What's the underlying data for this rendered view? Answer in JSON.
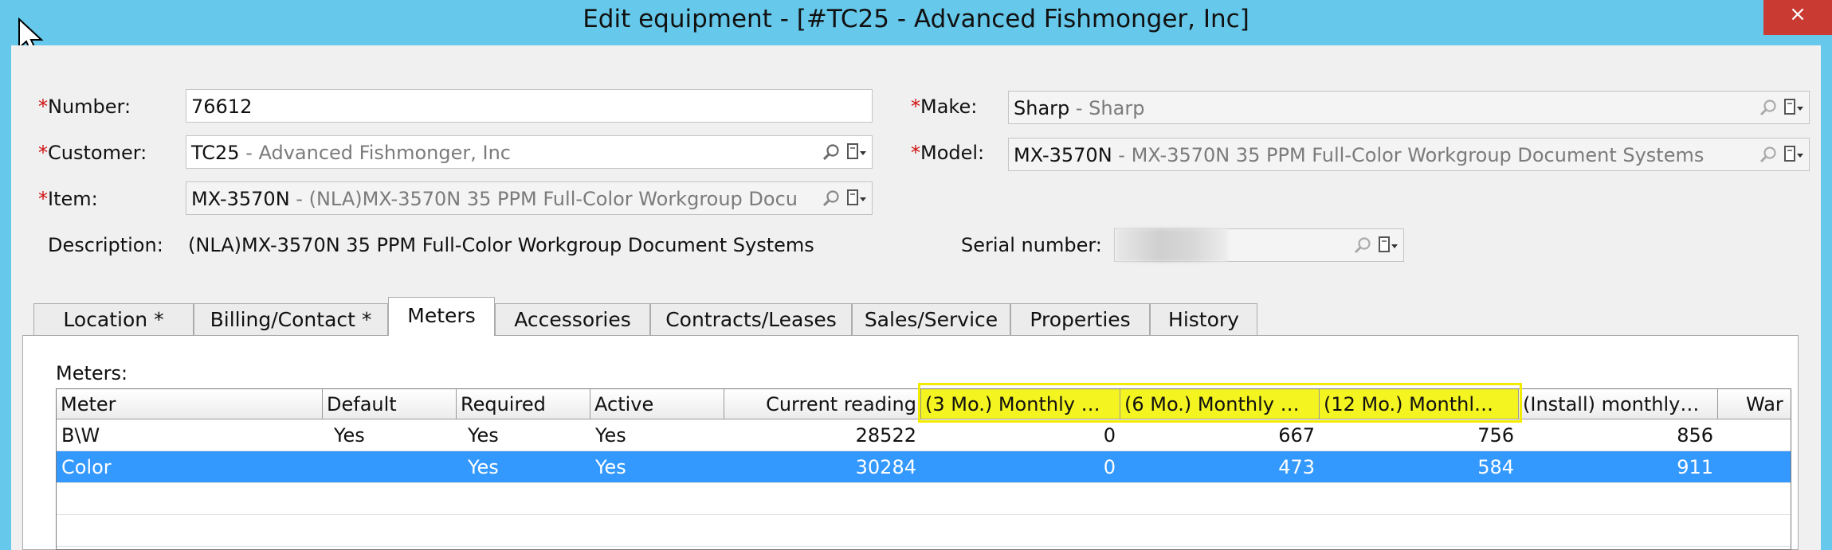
{
  "window": {
    "title": "Edit equipment - [#TC25 - Advanced Fishmonger, Inc]",
    "close_label": "×"
  },
  "form": {
    "required_mark": "*",
    "number": {
      "label": "Number:",
      "value": "76612"
    },
    "customer": {
      "label": "Customer:",
      "code": "TC25",
      "desc": " - Advanced Fishmonger, Inc"
    },
    "item": {
      "label": "Item:",
      "code": "MX-3570N",
      "desc": " - (NLA)MX-3570N 35 PPM Full-Color Workgroup Docu"
    },
    "description": {
      "label": "Description:",
      "value": "(NLA)MX-3570N 35 PPM Full-Color Workgroup Document Systems"
    },
    "make": {
      "label": "Make:",
      "code": "Sharp",
      "desc": " - Sharp"
    },
    "model": {
      "label": "Model:",
      "code": "MX-3570N",
      "desc": " - MX-3570N 35 PPM Full-Color Workgroup Document Systems"
    },
    "serial": {
      "label": "Serial number:",
      "value": ""
    }
  },
  "tabs": [
    {
      "label": "Location *"
    },
    {
      "label": "Billing/Contact *"
    },
    {
      "label": "Meters"
    },
    {
      "label": "Accessories"
    },
    {
      "label": "Contracts/Leases"
    },
    {
      "label": "Sales/Service"
    },
    {
      "label": "Properties"
    },
    {
      "label": "History"
    }
  ],
  "meters": {
    "section_label": "Meters:",
    "columns": [
      "Meter",
      "Default",
      "Required",
      "Active",
      "Current reading",
      "(3 Mo.) Monthly …",
      "(6 Mo.) Monthly …",
      "(12 Mo.) Monthl…",
      "(Install) monthly…",
      "War"
    ],
    "rows": [
      {
        "meter": "B\\W",
        "default": "Yes",
        "required": "Yes",
        "active": "Yes",
        "current": "28522",
        "mo3": "0",
        "mo6": "667",
        "mo12": "756",
        "install": "856"
      },
      {
        "meter": "Color",
        "default": "",
        "required": "Yes",
        "active": "Yes",
        "current": "30284",
        "mo3": "0",
        "mo6": "473",
        "mo12": "584",
        "install": "911"
      }
    ]
  }
}
